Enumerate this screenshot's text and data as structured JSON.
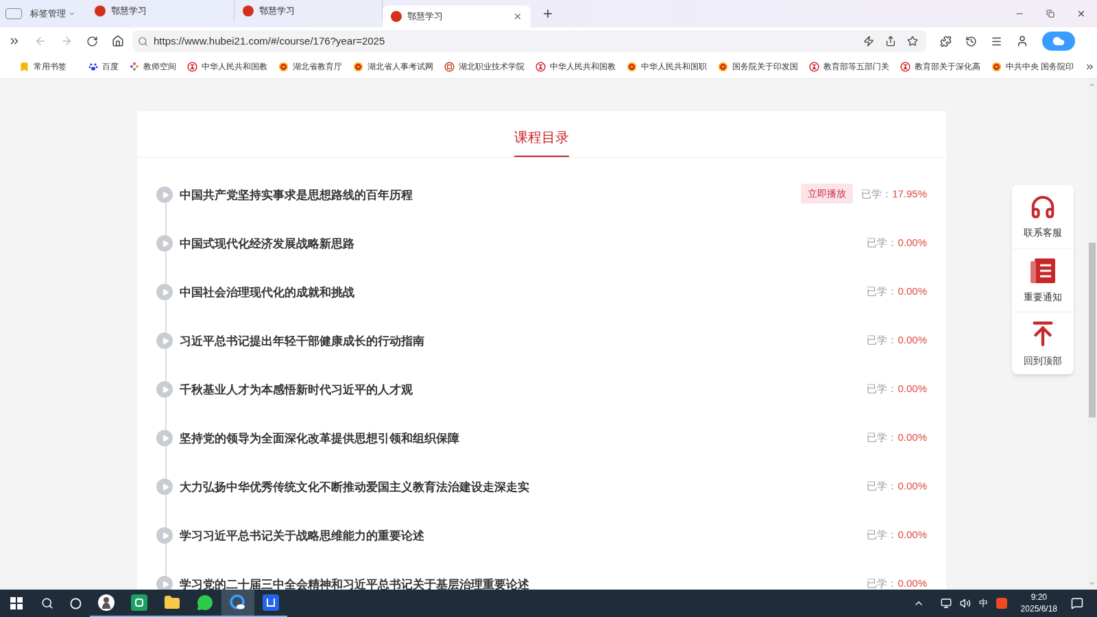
{
  "tab_manager": {
    "label": "标签管理"
  },
  "tabs": [
    {
      "title": "鄂慧学习",
      "selected": false
    },
    {
      "title": "鄂慧学习",
      "selected": false
    },
    {
      "title": "鄂慧学习",
      "selected": true
    }
  ],
  "address_bar": {
    "url": "https://www.hubei21.com/#/course/176?year=2025"
  },
  "bookmarks": [
    {
      "kind": "folder",
      "label": "常用书签"
    },
    {
      "kind": "paw",
      "label": "百度"
    },
    {
      "kind": "flower",
      "label": "教师空间"
    },
    {
      "kind": "seal",
      "label": "中华人民共和国教"
    },
    {
      "kind": "emblem",
      "label": "湖北省教育厅"
    },
    {
      "kind": "emblem",
      "label": "湖北省人事考试网"
    },
    {
      "kind": "school",
      "label": "湖北职业技术学院"
    },
    {
      "kind": "seal",
      "label": "中华人民共和国教"
    },
    {
      "kind": "emblem",
      "label": "中华人民共和国职"
    },
    {
      "kind": "emblem",
      "label": "国务院关于印发国"
    },
    {
      "kind": "seal",
      "label": "教育部等五部门关"
    },
    {
      "kind": "seal",
      "label": "教育部关于深化高"
    },
    {
      "kind": "emblem",
      "label": "中共中央 国务院印"
    }
  ],
  "catalog": {
    "heading": "课程目录",
    "lessons": [
      {
        "title": "中国共产党坚持实事求是思想路线的百年历程",
        "progress_label": "已学：",
        "progress": "17.95%",
        "play_button": "立即播放"
      },
      {
        "title": "中国式现代化经济发展战略新思路",
        "progress_label": "已学：",
        "progress": "0.00%"
      },
      {
        "title": "中国社会治理现代化的成就和挑战",
        "progress_label": "已学：",
        "progress": "0.00%"
      },
      {
        "title": "习近平总书记提出年轻干部健康成长的行动指南",
        "progress_label": "已学：",
        "progress": "0.00%"
      },
      {
        "title": "千秋基业人才为本感悟新时代习近平的人才观",
        "progress_label": "已学：",
        "progress": "0.00%"
      },
      {
        "title": "坚持党的领导为全面深化改革提供思想引领和组织保障",
        "progress_label": "已学：",
        "progress": "0.00%"
      },
      {
        "title": "大力弘扬中华优秀传统文化不断推动爱国主义教育法治建设走深走实",
        "progress_label": "已学：",
        "progress": "0.00%"
      },
      {
        "title": "学习习近平总书记关于战略思维能力的重要论述",
        "progress_label": "已学：",
        "progress": "0.00%"
      },
      {
        "title": "学习党的二十届三中全会精神和习近平总书记关于基层治理重要论述",
        "progress_label": "已学：",
        "progress": "0.00%"
      }
    ]
  },
  "side_panel": [
    {
      "kind": "service",
      "label": "联系客服"
    },
    {
      "kind": "notice",
      "label": "重要通知"
    },
    {
      "kind": "top",
      "label": "回到顶部"
    }
  ],
  "taskbar": {
    "apps": [
      {
        "kind": "avatar",
        "selected": false
      },
      {
        "kind": "sheets",
        "selected": false
      },
      {
        "kind": "folder",
        "selected": false
      },
      {
        "kind": "chat",
        "selected": false
      },
      {
        "kind": "browser",
        "selected": true
      },
      {
        "kind": "word",
        "selected": false
      }
    ],
    "ime": "中",
    "time": "9:20",
    "date": "2025/6/18"
  }
}
